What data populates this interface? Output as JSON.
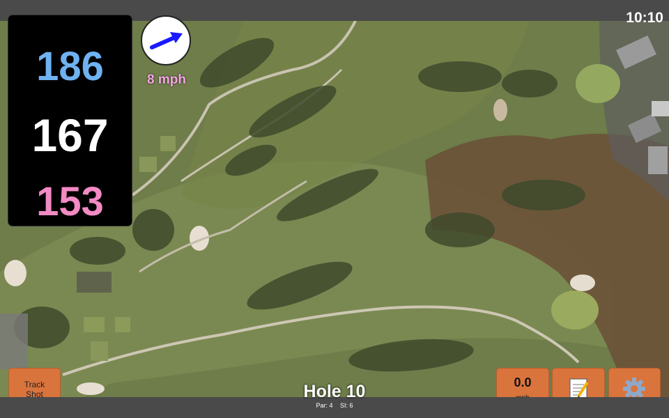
{
  "status_bar": {
    "clock": "10:10"
  },
  "distances": {
    "back": "186",
    "middle": "167",
    "front": "153"
  },
  "wind": {
    "speed_label": "8 mph",
    "icon": "wind-arrow-icon"
  },
  "buttons": {
    "track_shot_line1": "Track",
    "track_shot_line2": "Shot",
    "speed_value": "0.0",
    "speed_unit": "mph",
    "notes_icon": "notepad-icon",
    "settings_icon": "gear-icon"
  },
  "hole": {
    "title": "Hole 10",
    "par": "Par: 4",
    "si": "SI: 6"
  },
  "colors": {
    "back_distance": "#6fb2f2",
    "middle_distance": "#ffffff",
    "front_distance": "#f28ac4",
    "wind_label": "#f5a6e2",
    "button": "#d9743d",
    "fairway": "#6b7a47"
  }
}
